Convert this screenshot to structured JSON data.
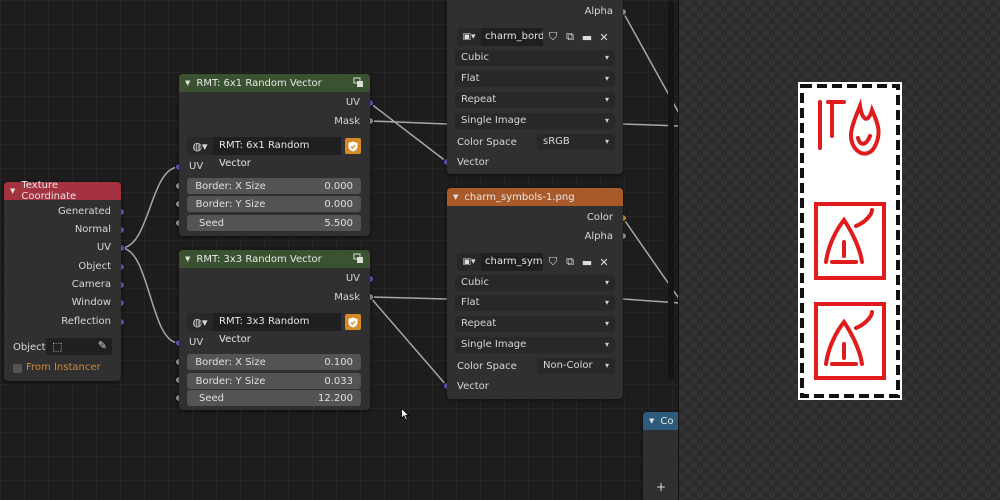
{
  "nodes": {
    "tex_coord": {
      "title": "Texture Coordinate",
      "outputs": [
        "Generated",
        "Normal",
        "UV",
        "Object",
        "Camera",
        "Window",
        "Reflection"
      ],
      "object_label": "Object:",
      "from_instancer": "From Instancer"
    },
    "rmt_6x1": {
      "title": "RMT: 6x1 Random Vector",
      "out_uv": "UV",
      "out_mask": "Mask",
      "group_name": "RMT: 6x1 Random Vector",
      "in_uv": "UV",
      "fields": [
        {
          "label": "Border: X Size",
          "value": "0.000"
        },
        {
          "label": "Border: Y Size",
          "value": "0.000"
        },
        {
          "label": "Seed",
          "value": "5.500"
        }
      ]
    },
    "rmt_3x3": {
      "title": "RMT: 3x3 Random Vector",
      "out_uv": "UV",
      "out_mask": "Mask",
      "group_name": "RMT: 3x3 Random Vector",
      "in_uv": "UV",
      "fields": [
        {
          "label": "Border: X Size",
          "value": "0.100"
        },
        {
          "label": "Border: Y Size",
          "value": "0.033"
        },
        {
          "label": "Seed",
          "value": "12.200"
        }
      ]
    },
    "image_top": {
      "out_alpha": "Alpha",
      "image_name": "charm_bord...",
      "interpolation": "Cubic",
      "projection": "Flat",
      "extension": "Repeat",
      "source": "Single Image",
      "color_space_label": "Color Space",
      "color_space": "sRGB",
      "in_vector": "Vector"
    },
    "image_bottom": {
      "title": "charm_symbols-1.png",
      "out_color": "Color",
      "out_alpha": "Alpha",
      "image_name": "charm_sym...",
      "interpolation": "Cubic",
      "projection": "Flat",
      "extension": "Repeat",
      "source": "Single Image",
      "color_space_label": "Color Space",
      "color_space": "Non-Color",
      "in_vector": "Vector"
    },
    "partial_node": {
      "title": "Co",
      "add_glyph": "+"
    }
  },
  "colors": {
    "vector_socket": "#6363c7",
    "float_socket": "#a1a1a1",
    "color_socket": "#c7a129",
    "group_header": "#3b5230",
    "input_header": "#a4333f",
    "texture_header": "#a85a2a",
    "charm_red": "#e01b1b"
  },
  "icons": {
    "dropdown": "chevron-down-icon",
    "node_group": "node-group-icon",
    "shield": "shield-icon",
    "browse_image": "image-browse-icon",
    "fake_user": "fake-user-shield-icon",
    "duplicate": "duplicate-icon",
    "open": "folder-icon",
    "unlink": "close-icon",
    "eyedropper": "eyedropper-icon",
    "object": "object-icon"
  }
}
